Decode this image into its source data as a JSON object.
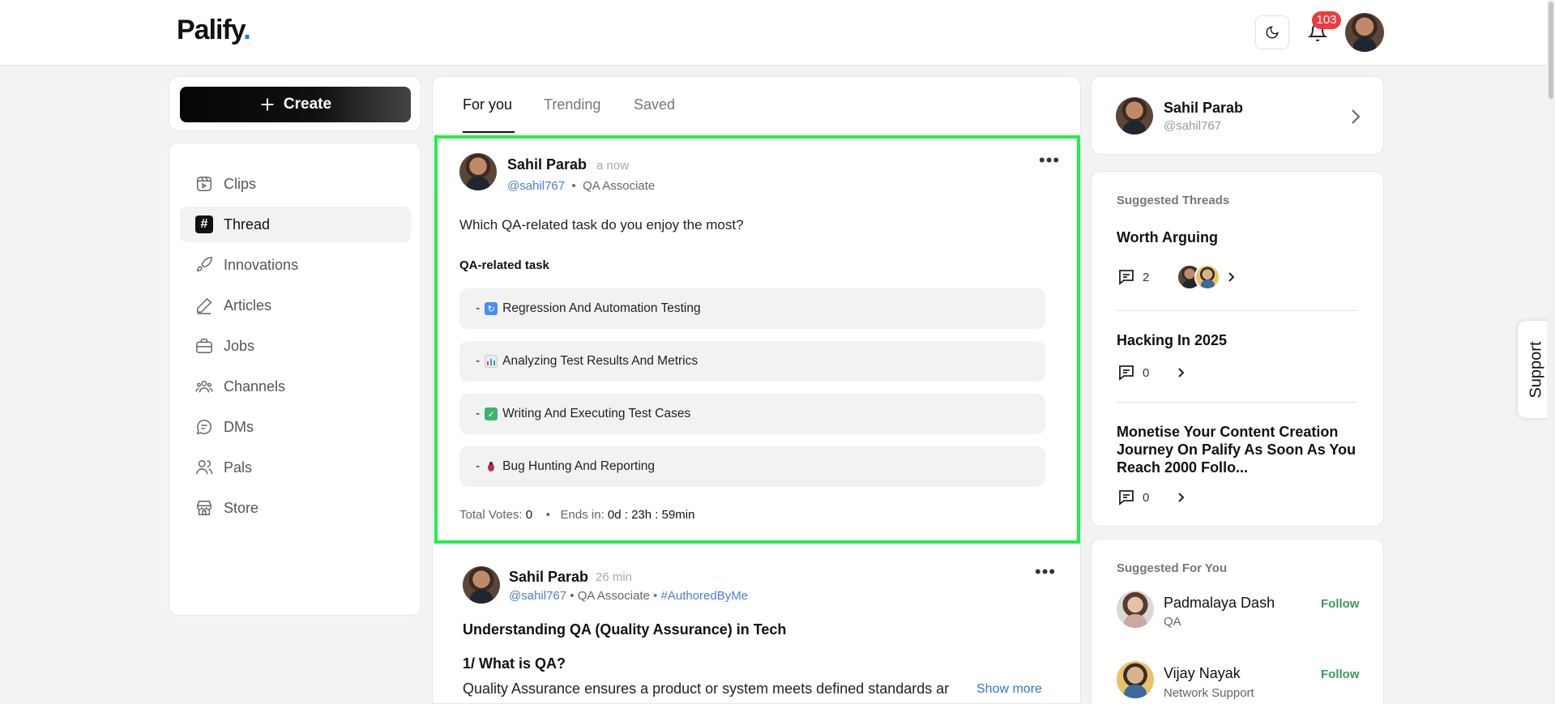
{
  "app": {
    "logo": "Palify",
    "logo_dot": ".",
    "notification_count": "103"
  },
  "sidebar": {
    "create_label": "Create",
    "items": [
      {
        "label": "Clips",
        "icon": "clips-icon"
      },
      {
        "label": "Thread",
        "icon": "hash-icon",
        "active": true
      },
      {
        "label": "Innovations",
        "icon": "rocket-icon"
      },
      {
        "label": "Articles",
        "icon": "pen-icon"
      },
      {
        "label": "Jobs",
        "icon": "briefcase-icon"
      },
      {
        "label": "Channels",
        "icon": "users-group-icon"
      },
      {
        "label": "DMs",
        "icon": "chat-icon"
      },
      {
        "label": "Pals",
        "icon": "pals-icon"
      },
      {
        "label": "Store",
        "icon": "store-icon"
      }
    ]
  },
  "feed": {
    "tabs": [
      {
        "label": "For you"
      },
      {
        "label": "Trending"
      },
      {
        "label": "Saved"
      }
    ],
    "post1": {
      "author": "Sahil Parab",
      "time": "a now",
      "handle": "@sahil767",
      "sep": "•",
      "role": "QA Associate",
      "question": "Which QA-related task do you enjoy the most?",
      "poll_title": "QA-related task",
      "options": [
        {
          "label": "Regression And Automation Testing",
          "emoji": "🔄"
        },
        {
          "label": "Analyzing Test Results And Metrics",
          "emoji": "📊"
        },
        {
          "label": "Writing And Executing Test Cases",
          "emoji": "✅"
        },
        {
          "label": "Bug Hunting And Reporting",
          "emoji": "🐞"
        }
      ],
      "dash": "-",
      "total_votes_label": "Total Votes:",
      "total_votes": "0",
      "ends_label": "Ends in:",
      "ends_value": "0d : 23h : 59min"
    },
    "post2": {
      "author": "Sahil Parab",
      "time": "26 min",
      "handle": "@sahil767",
      "role": "• QA Associate",
      "tag": "• #AuthoredByMe",
      "title": "Understanding QA (Quality Assurance) in Tech",
      "heading": "1/ What is QA?",
      "body": "Quality Assurance ensures a product or system meets defined standards ar",
      "show_more": "Show more"
    }
  },
  "profile": {
    "name": "Sahil Parab",
    "handle": "@sahil767"
  },
  "suggested_threads": {
    "title": "Suggested Threads",
    "items": [
      {
        "title": "Worth Arguing",
        "comments": "2"
      },
      {
        "title": "Hacking In 2025",
        "comments": "0"
      },
      {
        "title": "Monetise Your Content Creation Journey On Palify As Soon As You Reach 2000 Follo...",
        "comments": "0"
      }
    ]
  },
  "suggested_for_you": {
    "title": "Suggested For You",
    "follow_label": "Follow",
    "people": [
      {
        "name": "Padmalaya Dash",
        "role": "QA"
      },
      {
        "name": "Vijay Nayak",
        "role": "Network Support"
      }
    ]
  },
  "support_label": "Support",
  "colors": {
    "highlight": "#22ee4a",
    "link": "#4a7fd6",
    "follow": "#3a9a5b",
    "badge": "#ef3b3b"
  }
}
